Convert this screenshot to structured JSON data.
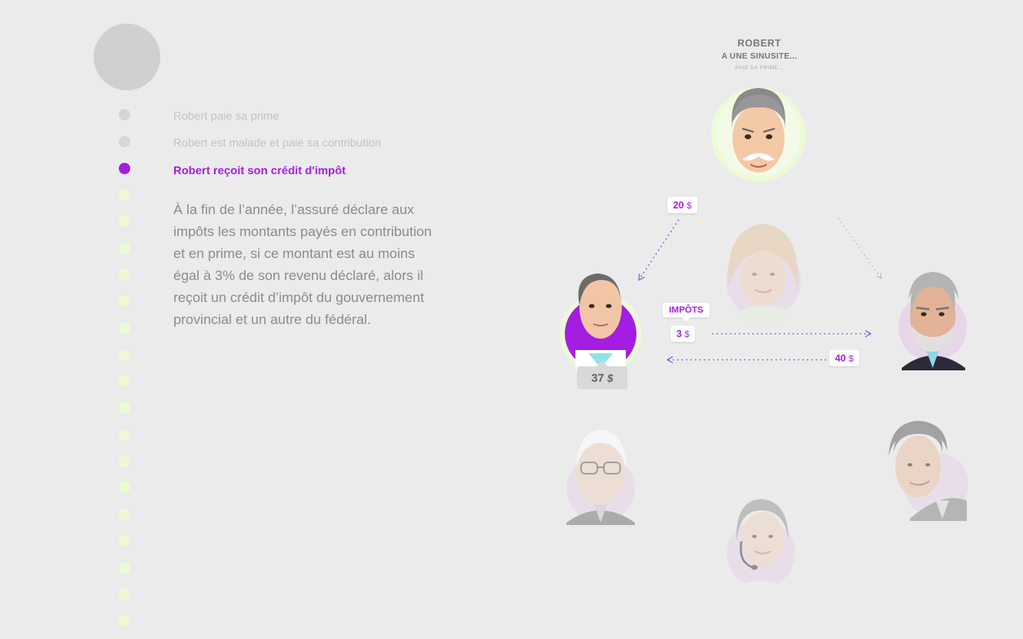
{
  "steps": [
    {
      "label": "Robert paie sa prime",
      "state": "done"
    },
    {
      "label": "Robert est malade et paie sa contribution",
      "state": "done"
    },
    {
      "label": "Robert reçoit son crédit d'impôt",
      "state": "active"
    }
  ],
  "upcoming_dots": 17,
  "description": "À la fin de l’année, l’assuré déclare aux impôts les montants payés en contribution et en prime, si ce montant est au moins égal à 3% de son revenu déclaré, alors il reçoit un crédit d’impôt du gouvernement provincial et un autre du fédéral.",
  "diagram": {
    "header": {
      "name": "ROBERT",
      "subtitle": "A UNE SINUSITE...",
      "subsubtitle": "PAIE SA PRIME..."
    },
    "tag_20": {
      "amount": "20",
      "currency": "$"
    },
    "tag_impots": {
      "label": "IMPÔTS"
    },
    "tag_3": {
      "amount": "3",
      "currency": "$"
    },
    "tag_40": {
      "amount": "40",
      "currency": "$"
    },
    "price": {
      "amount": "37",
      "currency": "$"
    }
  },
  "colors": {
    "accent": "#a31ee0",
    "upcoming_dot": "#ecfad2",
    "done_dot": "#d6d6d6",
    "background": "#ebebeb"
  }
}
